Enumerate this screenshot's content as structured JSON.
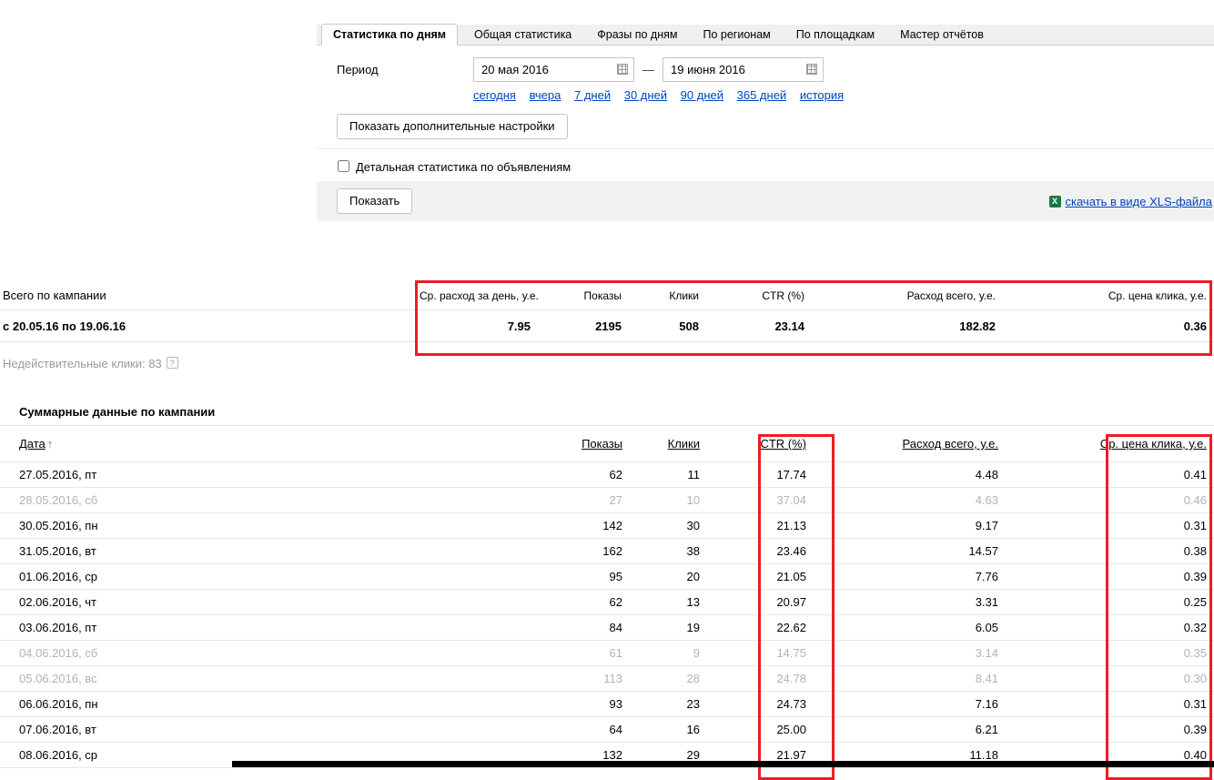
{
  "colors": {
    "highlight": "#ee1c25",
    "link": "#0044bb"
  },
  "tabs": [
    {
      "label": "Статистика по дням",
      "active": true
    },
    {
      "label": "Общая статистика",
      "active": false
    },
    {
      "label": "Фразы по дням",
      "active": false
    },
    {
      "label": "По регионам",
      "active": false
    },
    {
      "label": "По площадкам",
      "active": false
    },
    {
      "label": "Мастер отчётов",
      "active": false
    }
  ],
  "filter": {
    "period_label": "Период",
    "date_from": "20 мая 2016",
    "date_separator": "—",
    "date_to": "19 июня 2016",
    "quick_links": [
      "сегодня",
      "вчера",
      "7 дней",
      "30 дней",
      "90 дней",
      "365 дней",
      "история"
    ],
    "extra_settings_button": "Показать дополнительные настройки",
    "detailed_checkbox_label": "Детальная статистика по объявлениям",
    "show_button": "Показать",
    "xls_icon_letter": "X",
    "xls_link": "скачать в виде XLS-файла"
  },
  "summary": {
    "row_label": "Всего по кампании",
    "period_label": "с 20.05.16 по 19.06.16",
    "columns": [
      "Ср. расход за день, у.е.",
      "Показы",
      "Клики",
      "CTR (%)",
      "Расход всего, у.е.",
      "Ср. цена клика, у.е."
    ],
    "values": [
      "7.95",
      "2195",
      "508",
      "23.14",
      "182.82",
      "0.36"
    ],
    "invalid_clicks_label": "Недействительные клики: 83",
    "help_icon": "?"
  },
  "daily": {
    "title": "Суммарные данные по кампании",
    "columns": [
      "Дата",
      "Показы",
      "Клики",
      "CTR (%)",
      "Расход всего, у.е.",
      "Ср. цена клика, у.е."
    ],
    "sort_arrow": "↑",
    "rows": [
      {
        "date": "27.05.2016, пт",
        "shows": "62",
        "clicks": "11",
        "ctr": "17.74",
        "cost": "4.48",
        "cpc": "0.41"
      },
      {
        "date": "28.05.2016, сб",
        "shows": "27",
        "clicks": "10",
        "ctr": "37.04",
        "cost": "4.63",
        "cpc": "0.46"
      },
      {
        "date": "30.05.2016, пн",
        "shows": "142",
        "clicks": "30",
        "ctr": "21.13",
        "cost": "9.17",
        "cpc": "0.31"
      },
      {
        "date": "31.05.2016, вт",
        "shows": "162",
        "clicks": "38",
        "ctr": "23.46",
        "cost": "14.57",
        "cpc": "0.38"
      },
      {
        "date": "01.06.2016, ср",
        "shows": "95",
        "clicks": "20",
        "ctr": "21.05",
        "cost": "7.76",
        "cpc": "0.39"
      },
      {
        "date": "02.06.2016, чт",
        "shows": "62",
        "clicks": "13",
        "ctr": "20.97",
        "cost": "3.31",
        "cpc": "0.25"
      },
      {
        "date": "03.06.2016, пт",
        "shows": "84",
        "clicks": "19",
        "ctr": "22.62",
        "cost": "6.05",
        "cpc": "0.32"
      },
      {
        "date": "04.06.2016, сб",
        "shows": "61",
        "clicks": "9",
        "ctr": "14.75",
        "cost": "3.14",
        "cpc": "0.35"
      },
      {
        "date": "05.06.2016, вс",
        "shows": "113",
        "clicks": "28",
        "ctr": "24.78",
        "cost": "8.41",
        "cpc": "0.30"
      },
      {
        "date": "06.06.2016, пн",
        "shows": "93",
        "clicks": "23",
        "ctr": "24.73",
        "cost": "7.16",
        "cpc": "0.31"
      },
      {
        "date": "07.06.2016, вт",
        "shows": "64",
        "clicks": "16",
        "ctr": "25.00",
        "cost": "6.21",
        "cpc": "0.39"
      },
      {
        "date": "08.06.2016, ср",
        "shows": "132",
        "clicks": "29",
        "ctr": "21.97",
        "cost": "11.18",
        "cpc": "0.40"
      }
    ]
  }
}
